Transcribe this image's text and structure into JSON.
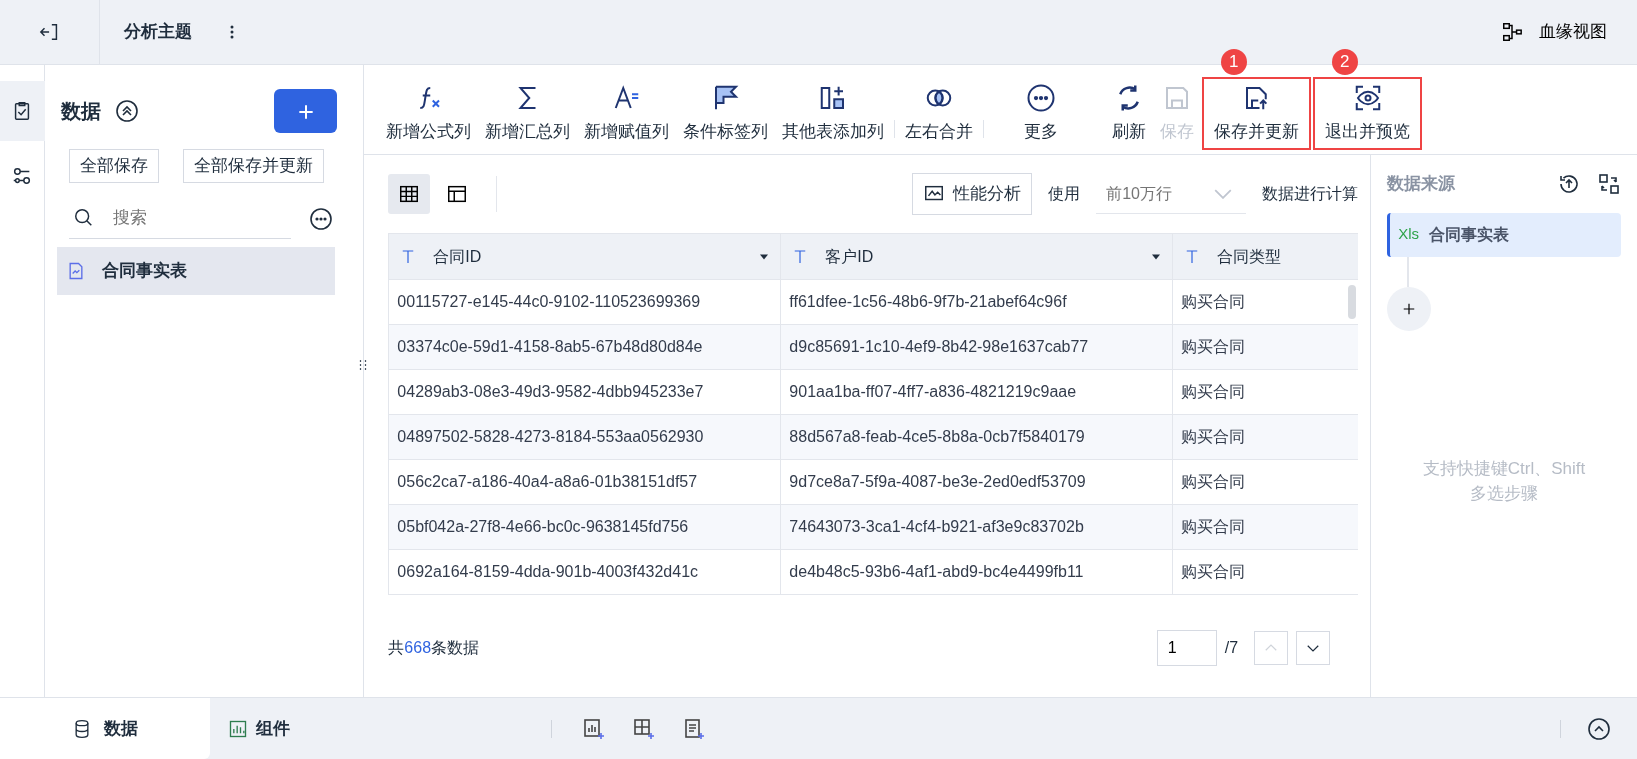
{
  "top_bar": {
    "title": "分析主题",
    "lineage_link": "血缘视图"
  },
  "left_panel": {
    "title": "数据",
    "buttons": [
      "全部保存",
      "全部保存并更新"
    ],
    "search": {
      "placeholder": "搜索"
    },
    "tables": [
      {
        "label": "合同事实表",
        "selected": true
      }
    ]
  },
  "toolbar": [
    {
      "kind": "action",
      "label": "新增公式列",
      "disabled": false
    },
    {
      "kind": "action",
      "label": "新增汇总列",
      "disabled": false
    },
    {
      "kind": "action",
      "label": "新增赋值列",
      "disabled": false
    },
    {
      "kind": "action",
      "label": "条件标签列",
      "disabled": false
    },
    {
      "kind": "action",
      "label": "其他表添加列",
      "disabled": false
    },
    {
      "kind": "separator"
    },
    {
      "kind": "action",
      "label": "左右合并",
      "disabled": false
    },
    {
      "kind": "separator"
    },
    {
      "kind": "action",
      "label": "更多",
      "disabled": false
    },
    {
      "kind": "action",
      "label": "刷新",
      "disabled": false
    },
    {
      "kind": "action",
      "label": "保存",
      "disabled": true
    },
    {
      "kind": "action",
      "label": "保存并更新",
      "disabled": false,
      "callout": "1"
    },
    {
      "kind": "action",
      "label": "退出并预览",
      "disabled": false,
      "callout": "2"
    }
  ],
  "view_toggles": [
    {
      "selected": true
    },
    {
      "selected": false
    }
  ],
  "perf_button": "性能分析",
  "use_label": "使用",
  "row_limit": {
    "placeholder": "前10万行"
  },
  "compute_label": "数据进行计算",
  "table": {
    "columns": [
      "合同ID",
      "客户ID",
      "合同类型"
    ],
    "rows": [
      [
        "00115727-e145-44c0-9102-110523699369",
        "ff61dfee-1c56-48b6-9f7b-21abef64c96f",
        "购买合同"
      ],
      [
        "03374c0e-59d1-4158-8ab5-67b48d80d84e",
        "d9c85691-1c10-4ef9-8b42-98e1637cab77",
        "购买合同"
      ],
      [
        "04289ab3-08e3-49d3-9582-4dbb945233e7",
        "901aa1ba-ff07-4ff7-a836-4821219c9aae",
        "购买合同"
      ],
      [
        "04897502-5828-4273-8184-553aa0562930",
        "88d567a8-feab-4ce5-8b8a-0cb7f5840179",
        "购买合同"
      ],
      [
        "056c2ca7-a186-40a4-a8a6-01b38151df57",
        "9d7ce8a7-5f9a-4087-be3e-2ed0edf53709",
        "购买合同"
      ],
      [
        "05bf042a-27f8-4e66-bc0c-9638145fd756",
        "74643073-3ca1-4cf4-b921-af3e9c83702b",
        "购买合同"
      ],
      [
        "0692a164-8159-4dda-901b-4003f432d41c",
        "de4b48c5-93b6-4af1-abd9-bc4e4499fb11",
        "购买合同"
      ]
    ]
  },
  "footer": {
    "prefix": "共",
    "count": "668",
    "suffix": "条数据"
  },
  "pager": {
    "page": "1",
    "total": "/7"
  },
  "right_panel": {
    "title": "数据来源",
    "steps": [
      {
        "badge": "Xls",
        "label": "合同事实表",
        "selected": true
      }
    ],
    "hint": "支持快捷键Ctrl、Shift多选步骤"
  },
  "bottom_tabs": [
    {
      "label": "数据",
      "selected": true
    },
    {
      "label": "组件",
      "selected": false
    }
  ]
}
